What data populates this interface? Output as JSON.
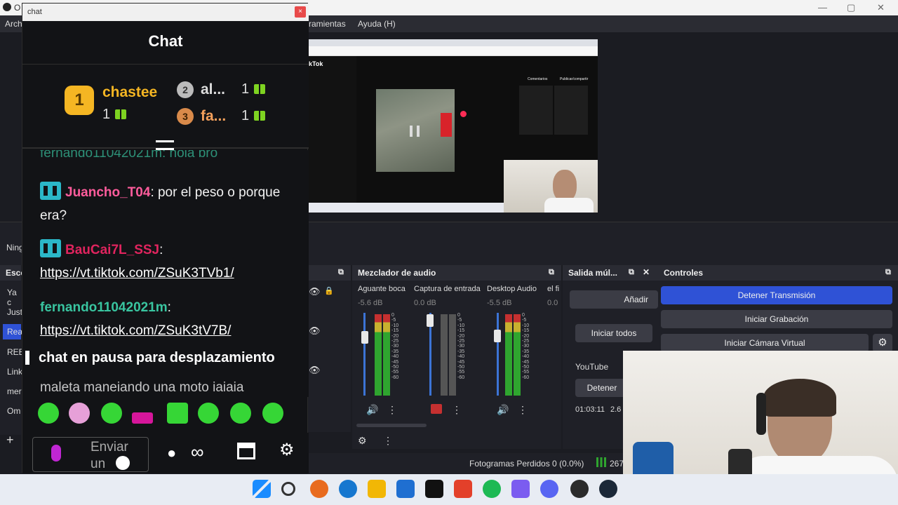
{
  "window": {
    "title": "O",
    "min_glyph": "—",
    "max_glyph": "▢",
    "close_glyph": "✕"
  },
  "menu": {
    "items": [
      "Arch",
      "ramientas",
      "Ayuda (H)"
    ]
  },
  "chat": {
    "window_title": "chat",
    "close_glyph": "×",
    "header": "Chat",
    "leaderboard": [
      {
        "rank": "1",
        "name": "chastee",
        "count": "1"
      },
      {
        "rank": "2",
        "name": "al...",
        "count": "1"
      },
      {
        "rank": "3",
        "name": "fa...",
        "count": "1"
      }
    ],
    "partial_top": "fernando11042021m: hola bro",
    "messages": [
      {
        "user": "Juancho_T04",
        "user_color": "#ff5c9c",
        "text": ": por el peso o porque era?"
      },
      {
        "user": "BauCai7L_SSJ",
        "user_color": "#e0245e",
        "text": ":",
        "link": "https://vt.tiktok.com/ZSuK3TVb1/"
      },
      {
        "user": "fernando11042021m",
        "user_color": "#39c5a0",
        "text": ":",
        "link": "https://vt.tiktok.com/ZSuK3tV7B/"
      }
    ],
    "pause_text": "chat en pausa para desplazamiento",
    "partial_bottom": "maleta manejando una moto jajaja",
    "input_placeholder": "Enviar un"
  },
  "obs": {
    "scene_label": "Ning",
    "scenes_title": "Esce",
    "scenes": [
      "Ya c",
      "Just",
      "Rea",
      "REE",
      "Link",
      "mer",
      "Om"
    ],
    "mixer": {
      "title": "Mezclador de audio",
      "channels": [
        {
          "name": "Aguante boca",
          "db": "-5.6 dB"
        },
        {
          "name": "Captura de entrada",
          "db": "0.0 dB"
        },
        {
          "name": "Desktop Audio",
          "db": "-5.5 dB"
        },
        {
          "name": "el fi",
          "db": "0.0"
        }
      ],
      "scale": [
        "0",
        "-5",
        "-10",
        "-15",
        "-20",
        "-25",
        "-30",
        "-35",
        "-40",
        "-45",
        "-50",
        "-55",
        "-60"
      ]
    },
    "multi_output": {
      "title": "Salida múl...",
      "add_label": "Añadir",
      "start_all": "Iniciar todos",
      "youtube": "YouTube",
      "stop": "Detener",
      "time": "01:03:11",
      "rate": "2.6"
    },
    "controls": {
      "title": "Controles",
      "stop_stream": "Detener Transmisión",
      "start_record": "Iniciar Grabación",
      "start_vcam": "Iniciar Cámara Virtual"
    },
    "status": {
      "dropped": "Fotogramas Perdidos 0 (0.0%)",
      "bitrate": "267"
    }
  },
  "preview": {
    "tiktok_label": "kTok",
    "tab_1": "Comentarios",
    "tab_2": "Publicar/compartir"
  },
  "colors": {
    "accent": "#2f52d6",
    "tiktok_red": "#fe2c55"
  }
}
